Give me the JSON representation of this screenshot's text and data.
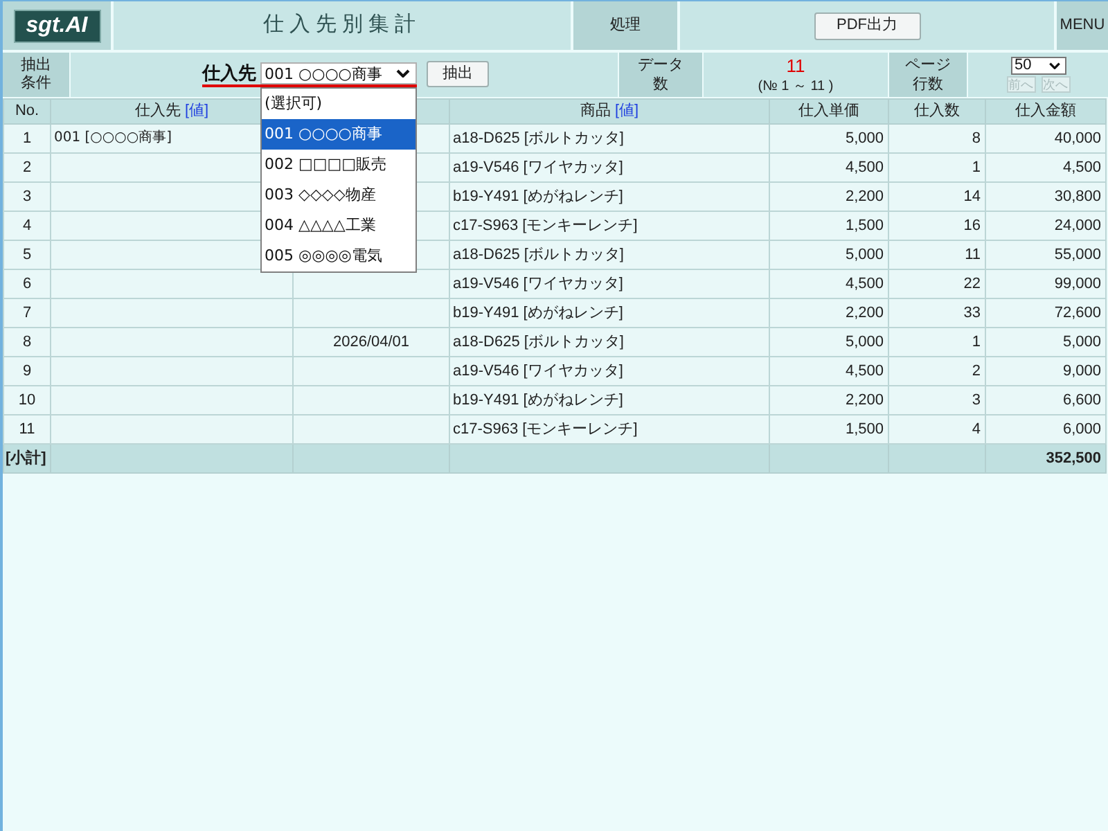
{
  "header": {
    "logo": "sgt.AI",
    "title": "仕入先別集計",
    "process_label": "処理",
    "pdf_button": "PDF出力",
    "menu_button": "MENU"
  },
  "filter_bar": {
    "label": "抽出条件",
    "supplier_label": "仕入先",
    "supplier_select": {
      "value": "001 ○○○○商事",
      "expanded": true,
      "options": [
        {
          "label": "(選択可)",
          "selected": false
        },
        {
          "label": "001 ○○○○商事",
          "selected": true
        },
        {
          "label": "002 □□□□販売",
          "selected": false
        },
        {
          "label": "003 ◇◇◇◇物産",
          "selected": false
        },
        {
          "label": "004 △△△△工業",
          "selected": false
        },
        {
          "label": "005 ◎◎◎◎電気",
          "selected": false
        }
      ]
    },
    "extract_button": "抽出",
    "count_label": "データ数",
    "count": "11",
    "count_range": "(№ 1 ～ 11 )",
    "page_rows_label": "ページ行数",
    "page_rows_select": "50",
    "prev_button": {
      "label": "前へ",
      "disabled": true
    },
    "next_button": {
      "label": "次へ",
      "disabled": true
    }
  },
  "table": {
    "columns": [
      {
        "label": "No."
      },
      {
        "label": "仕入先",
        "link": "[値]"
      },
      {},
      {
        "label": "商品",
        "link": "[値]"
      },
      {
        "label": "仕入単価"
      },
      {
        "label": "仕入数"
      },
      {
        "label": "仕入金額"
      }
    ],
    "rows": [
      {
        "no": "1",
        "supplier": "001 [○○○○商事]",
        "product": "a18-D625 [ボルトカッタ]",
        "unit_price": "5,000",
        "quantity": "8",
        "amount": "40,000"
      },
      {
        "no": "2",
        "product": "a19-V546 [ワイヤカッタ]",
        "unit_price": "4,500",
        "quantity": "1",
        "amount": "4,500"
      },
      {
        "no": "3",
        "product": "b19-Y491 [めがねレンチ]",
        "unit_price": "2,200",
        "quantity": "14",
        "amount": "30,800"
      },
      {
        "no": "4",
        "product": "c17-S963 [モンキーレンチ]",
        "unit_price": "1,500",
        "quantity": "16",
        "amount": "24,000"
      },
      {
        "no": "5",
        "product": "a18-D625 [ボルトカッタ]",
        "unit_price": "5,000",
        "quantity": "11",
        "amount": "55,000"
      },
      {
        "no": "6",
        "product": "a19-V546 [ワイヤカッタ]",
        "unit_price": "4,500",
        "quantity": "22",
        "amount": "99,000"
      },
      {
        "no": "7",
        "product": "b19-Y491 [めがねレンチ]",
        "unit_price": "2,200",
        "quantity": "33",
        "amount": "72,600"
      },
      {
        "no": "8",
        "column_3": "2026/04/01",
        "product": "a18-D625 [ボルトカッタ]",
        "unit_price": "5,000",
        "quantity": "1",
        "amount": "5,000"
      },
      {
        "no": "9",
        "product": "a19-V546 [ワイヤカッタ]",
        "unit_price": "4,500",
        "quantity": "2",
        "amount": "9,000"
      },
      {
        "no": "10",
        "product": "b19-Y491 [めがねレンチ]",
        "unit_price": "2,200",
        "quantity": "3",
        "amount": "6,600"
      },
      {
        "no": "11",
        "product": "c17-S963 [モンキーレンチ]",
        "unit_price": "1,500",
        "quantity": "4",
        "amount": "6,000"
      }
    ],
    "subtotal": {
      "label": "[小計]",
      "amount": "352,500"
    }
  }
}
